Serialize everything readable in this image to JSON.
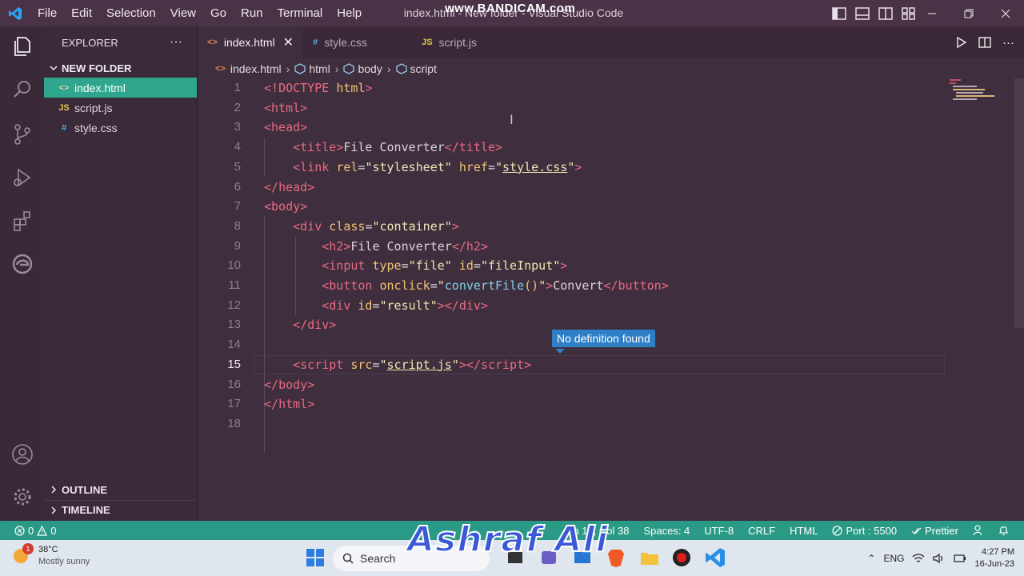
{
  "window": {
    "title": "index.html - New folder - Visual Studio Code",
    "recorder_watermark": "www.BANDICAM.com"
  },
  "menu": [
    "File",
    "Edit",
    "Selection",
    "View",
    "Go",
    "Run",
    "Terminal",
    "Help"
  ],
  "explorer": {
    "header": "EXPLORER",
    "more": "···",
    "folder": "NEW FOLDER",
    "files": [
      {
        "name": "index.html",
        "icon": "<>",
        "icon_color": "#e4854f",
        "active": true
      },
      {
        "name": "script.js",
        "icon": "JS",
        "icon_color": "#e5c84b",
        "active": false
      },
      {
        "name": "style.css",
        "icon": "#",
        "icon_color": "#5fa9e6",
        "active": false
      }
    ],
    "outline": "OUTLINE",
    "timeline": "TIMELINE"
  },
  "tabs": [
    {
      "label": "index.html",
      "icon": "<>",
      "icon_color": "#e4854f",
      "active": true,
      "close": "✕"
    },
    {
      "label": "style.css",
      "icon": "#",
      "icon_color": "#5fa9e6",
      "active": false
    },
    {
      "label": "script.js",
      "icon": "JS",
      "icon_color": "#e5c84b",
      "active": false
    }
  ],
  "breadcrumb": [
    "index.html",
    "html",
    "body",
    "script"
  ],
  "editor": {
    "current_line": 15,
    "hover_tooltip": "No definition found",
    "lines": [
      [
        [
          "t",
          "<!"
        ],
        [
          "t",
          "DOCTYPE"
        ],
        [
          "p",
          " "
        ],
        [
          "a",
          "html"
        ],
        [
          "t",
          ">"
        ]
      ],
      [
        [
          "t",
          "<"
        ],
        [
          "t",
          "html"
        ],
        [
          "t",
          ">"
        ]
      ],
      [
        [
          "t",
          "<"
        ],
        [
          "t",
          "head"
        ],
        [
          "t",
          ">"
        ]
      ],
      [
        [
          "p",
          "    "
        ],
        [
          "t",
          "<"
        ],
        [
          "t",
          "title"
        ],
        [
          "t",
          ">"
        ],
        [
          "p",
          "File Converter"
        ],
        [
          "t",
          "</"
        ],
        [
          "t",
          "title"
        ],
        [
          "t",
          ">"
        ]
      ],
      [
        [
          "p",
          "    "
        ],
        [
          "t",
          "<"
        ],
        [
          "t",
          "link"
        ],
        [
          "p",
          " "
        ],
        [
          "a",
          "rel"
        ],
        [
          "p",
          "="
        ],
        [
          "s",
          "\"stylesheet\""
        ],
        [
          "p",
          " "
        ],
        [
          "a",
          "href"
        ],
        [
          "p",
          "="
        ],
        [
          "s",
          "\""
        ],
        [
          "su",
          "style.css"
        ],
        [
          "s",
          "\""
        ],
        [
          "t",
          ">"
        ]
      ],
      [
        [
          "t",
          "</"
        ],
        [
          "t",
          "head"
        ],
        [
          "t",
          ">"
        ]
      ],
      [
        [
          "t",
          "<"
        ],
        [
          "t",
          "body"
        ],
        [
          "t",
          ">"
        ]
      ],
      [
        [
          "p",
          "    "
        ],
        [
          "t",
          "<"
        ],
        [
          "t",
          "div"
        ],
        [
          "p",
          " "
        ],
        [
          "a",
          "class"
        ],
        [
          "p",
          "="
        ],
        [
          "s",
          "\"container\""
        ],
        [
          "t",
          ">"
        ]
      ],
      [
        [
          "p",
          "        "
        ],
        [
          "t",
          "<"
        ],
        [
          "t",
          "h2"
        ],
        [
          "t",
          ">"
        ],
        [
          "p",
          "File Converter"
        ],
        [
          "t",
          "</"
        ],
        [
          "t",
          "h2"
        ],
        [
          "t",
          ">"
        ]
      ],
      [
        [
          "p",
          "        "
        ],
        [
          "t",
          "<"
        ],
        [
          "t",
          "input"
        ],
        [
          "p",
          " "
        ],
        [
          "a",
          "type"
        ],
        [
          "p",
          "="
        ],
        [
          "s",
          "\"file\""
        ],
        [
          "p",
          " "
        ],
        [
          "a",
          "id"
        ],
        [
          "p",
          "="
        ],
        [
          "s",
          "\"fileInput\""
        ],
        [
          "t",
          ">"
        ]
      ],
      [
        [
          "p",
          "        "
        ],
        [
          "t",
          "<"
        ],
        [
          "t",
          "button"
        ],
        [
          "p",
          " "
        ],
        [
          "a",
          "onclick"
        ],
        [
          "p",
          "="
        ],
        [
          "s",
          "\""
        ],
        [
          "f",
          "convertFile"
        ],
        [
          "a",
          "()"
        ],
        [
          "s",
          "\""
        ],
        [
          "t",
          ">"
        ],
        [
          "p",
          "Convert"
        ],
        [
          "t",
          "</"
        ],
        [
          "t",
          "button"
        ],
        [
          "t",
          ">"
        ]
      ],
      [
        [
          "p",
          "        "
        ],
        [
          "t",
          "<"
        ],
        [
          "t",
          "div"
        ],
        [
          "p",
          " "
        ],
        [
          "a",
          "id"
        ],
        [
          "p",
          "="
        ],
        [
          "s",
          "\"result\""
        ],
        [
          "t",
          "></"
        ],
        [
          "t",
          "div"
        ],
        [
          "t",
          ">"
        ]
      ],
      [
        [
          "p",
          "    "
        ],
        [
          "t",
          "</"
        ],
        [
          "t",
          "div"
        ],
        [
          "t",
          ">"
        ]
      ],
      [],
      [
        [
          "p",
          "    "
        ],
        [
          "t",
          "<"
        ],
        [
          "t",
          "script"
        ],
        [
          "p",
          " "
        ],
        [
          "a",
          "src"
        ],
        [
          "p",
          "="
        ],
        [
          "s",
          "\""
        ],
        [
          "su",
          "script.js"
        ],
        [
          "s",
          "\""
        ],
        [
          "t",
          "></"
        ],
        [
          "t",
          "script"
        ],
        [
          "t",
          ">"
        ]
      ],
      [
        [
          "t",
          "</"
        ],
        [
          "t",
          "body"
        ],
        [
          "t",
          ">"
        ]
      ],
      [
        [
          "t",
          "</"
        ],
        [
          "t",
          "html"
        ],
        [
          "t",
          ">"
        ]
      ],
      []
    ]
  },
  "status": {
    "errors": "0",
    "warnings": "0",
    "cursor": "Ln 15, Col 38",
    "spaces": "Spaces: 4",
    "encoding": "UTF-8",
    "eol": "CRLF",
    "language": "HTML",
    "port": "Port : 5500",
    "formatter": "Prettier"
  },
  "taskbar": {
    "weather_temp": "38°C",
    "weather_desc": "Mostly sunny",
    "weather_badge": "1",
    "search": "Search",
    "lang": "ENG",
    "time": "4:27 PM",
    "date": "16-Jun-23"
  },
  "overlay_name": "Ashraf Ali",
  "colors": {
    "status_bar": "#2a9a86",
    "active_file": "#2fa78e",
    "tooltip": "#2e7fc5",
    "tag": "#e96a83",
    "attr": "#f3c274",
    "string": "#f1e6b2"
  }
}
